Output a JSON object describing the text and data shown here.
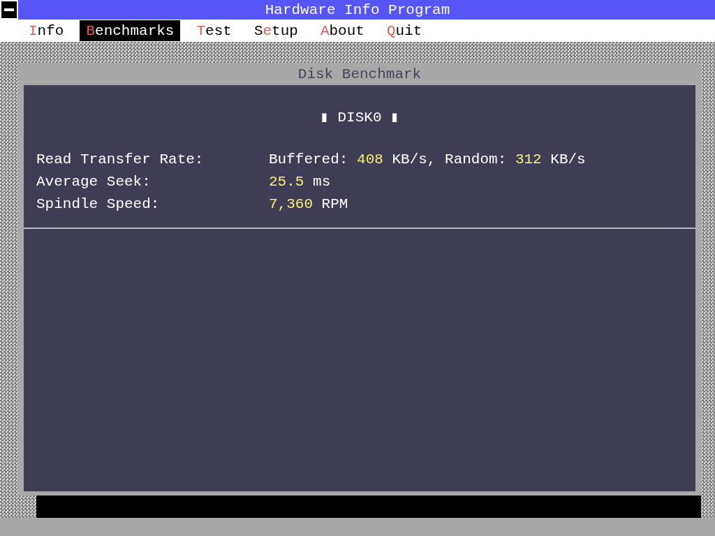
{
  "window": {
    "title": "Hardware Info Program"
  },
  "menu": [
    {
      "hotkey": "I",
      "after": "nfo",
      "selected": false
    },
    {
      "hotkey": "B",
      "after": "enchmarks",
      "selected": true
    },
    {
      "hotkey": "T",
      "after": "est",
      "selected": false
    },
    {
      "before": "S",
      "hotkey": "e",
      "after": "tup",
      "selected": false
    },
    {
      "hotkey": "A",
      "after": "bout",
      "selected": false
    },
    {
      "hotkey": "Q",
      "after": "uit",
      "selected": false
    }
  ],
  "dialog": {
    "title": "Disk Benchmark",
    "heading": "▮ DISK0 ▮",
    "rows": [
      {
        "label": "Read Transfer Rate:",
        "value": [
          {
            "text": "Buffered: ",
            "highlight": false
          },
          {
            "text": "408",
            "highlight": true
          },
          {
            "text": " KB/s, Random: ",
            "highlight": false
          },
          {
            "text": "312",
            "highlight": true
          },
          {
            "text": " KB/s",
            "highlight": false
          }
        ]
      },
      {
        "label": "Average Seek:",
        "value": [
          {
            "text": "25.5",
            "highlight": true
          },
          {
            "text": " ms",
            "highlight": false
          }
        ]
      },
      {
        "label": "Spindle Speed:",
        "value": [
          {
            "text": "7,360",
            "highlight": true
          },
          {
            "text": " RPM",
            "highlight": false
          }
        ]
      }
    ]
  }
}
